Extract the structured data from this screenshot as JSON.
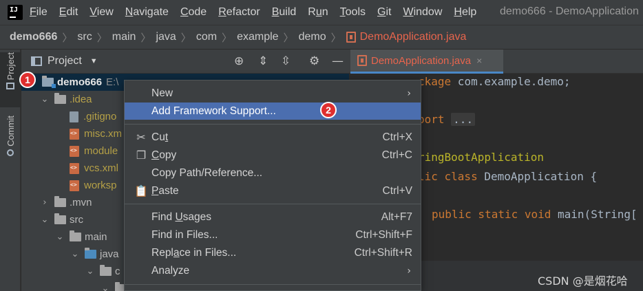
{
  "menubar": {
    "items": [
      {
        "pre": "",
        "u": "F",
        "post": "ile"
      },
      {
        "pre": "",
        "u": "E",
        "post": "dit"
      },
      {
        "pre": "",
        "u": "V",
        "post": "iew"
      },
      {
        "pre": "",
        "u": "N",
        "post": "avigate"
      },
      {
        "pre": "",
        "u": "C",
        "post": "ode"
      },
      {
        "pre": "",
        "u": "R",
        "post": "efactor"
      },
      {
        "pre": "",
        "u": "B",
        "post": "uild"
      },
      {
        "pre": "R",
        "u": "u",
        "post": "n"
      },
      {
        "pre": "",
        "u": "T",
        "post": "ools"
      },
      {
        "pre": "",
        "u": "G",
        "post": "it"
      },
      {
        "pre": "",
        "u": "W",
        "post": "indow"
      },
      {
        "pre": "",
        "u": "H",
        "post": "elp"
      }
    ],
    "window_title": "demo666 - DemoApplication"
  },
  "breadcrumb": {
    "items": [
      "demo666",
      "src",
      "main",
      "java",
      "com",
      "example",
      "demo"
    ],
    "active_file": "DemoApplication.java"
  },
  "left_strip": {
    "project_label": "Project",
    "commit_label": "Commit"
  },
  "project_panel": {
    "title": "Project",
    "icons": [
      "crosshair-icon",
      "expand-all-icon",
      "collapse-all-icon",
      "gear-icon",
      "minimize-icon"
    ]
  },
  "editor_tab": {
    "label": "DemoApplication.java",
    "close": "×"
  },
  "tree": {
    "root_name": "demo666",
    "root_path": "E:\\",
    "idea": ".idea",
    "gitignore": ".gitigno",
    "misc": "misc.xm",
    "modules": "module",
    "vcs": "vcs.xml",
    "workspace": "worksp",
    "mvn": ".mvn",
    "src": "src",
    "main": "main",
    "java": "java",
    "com": "c"
  },
  "badges": {
    "one": "1",
    "two": "2"
  },
  "code": {
    "package_kw": "ckage",
    "package_name": " com.example.demo;",
    "import_kw": "port",
    "import_fold": "...",
    "annotation": "ringBootApplication",
    "class_kw": "lic class",
    "class_name": " DemoApplication {",
    "method_kw": "public static void",
    "method_name": " main(String["
  },
  "context_menu": {
    "new": {
      "label": "New"
    },
    "add_framework": {
      "label": "Add Framework Support..."
    },
    "cut": {
      "pre": "Cu",
      "u": "t",
      "post": "",
      "shortcut": "Ctrl+X"
    },
    "copy": {
      "pre": "",
      "u": "C",
      "post": "opy",
      "shortcut": "Ctrl+C"
    },
    "copy_path": {
      "label": "Copy Path/Reference..."
    },
    "paste": {
      "pre": "",
      "u": "P",
      "post": "aste",
      "shortcut": "Ctrl+V"
    },
    "find_usages": {
      "pre": "Find ",
      "u": "U",
      "post": "sages",
      "shortcut": "Alt+F7"
    },
    "find_in_files": {
      "label": "Find in Files...",
      "shortcut": "Ctrl+Shift+F"
    },
    "replace_in_files": {
      "pre": "Repl",
      "u": "a",
      "post": "ce in Files...",
      "shortcut": "Ctrl+Shift+R"
    },
    "analyze": {
      "label": "Analyze"
    }
  },
  "watermark": "CSDN @是烟花哈",
  "colors": {
    "highlight": "#4b6eaf",
    "badge": "#e02f2f",
    "active_file": "#e8654d"
  }
}
